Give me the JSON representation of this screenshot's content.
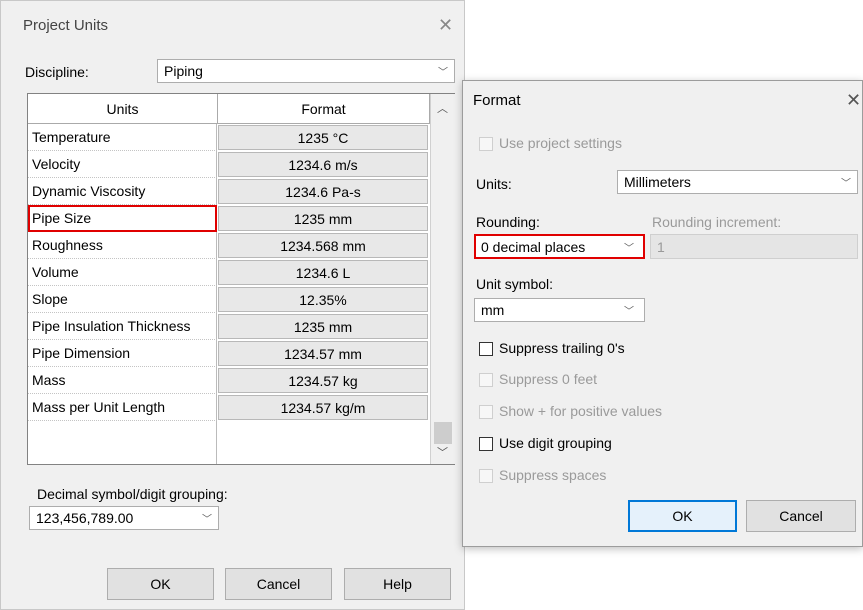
{
  "project_units": {
    "title": "Project Units",
    "discipline_label": "Discipline:",
    "discipline_value": "Piping",
    "table": {
      "headers": [
        "Units",
        "Format"
      ],
      "rows": [
        {
          "unit": "Temperature",
          "format": "1235 °C"
        },
        {
          "unit": "Velocity",
          "format": "1234.6 m/s"
        },
        {
          "unit": "Dynamic Viscosity",
          "format": "1234.6 Pa-s"
        },
        {
          "unit": "Pipe Size",
          "format": "1235 mm"
        },
        {
          "unit": "Roughness",
          "format": "1234.568 mm"
        },
        {
          "unit": "Volume",
          "format": "1234.6 L"
        },
        {
          "unit": "Slope",
          "format": "12.35%"
        },
        {
          "unit": "Pipe Insulation Thickness",
          "format": "1235 mm"
        },
        {
          "unit": "Pipe Dimension",
          "format": "1234.57 mm"
        },
        {
          "unit": "Mass",
          "format": "1234.57 kg"
        },
        {
          "unit": "Mass per Unit Length",
          "format": "1234.57 kg/m"
        }
      ]
    },
    "decimal_label": "Decimal symbol/digit grouping:",
    "decimal_value": "123,456,789.00",
    "ok_label": "OK",
    "cancel_label": "Cancel",
    "help_label": "Help"
  },
  "format": {
    "title": "Format",
    "use_project_settings": "Use project settings",
    "units_label": "Units:",
    "units_value": "Millimeters",
    "rounding_label": "Rounding:",
    "rounding_value": "0 decimal places",
    "rounding_increment_label": "Rounding increment:",
    "rounding_increment_value": "1",
    "unit_symbol_label": "Unit symbol:",
    "unit_symbol_value": "mm",
    "suppress_trailing": "Suppress trailing 0's",
    "suppress_feet": "Suppress 0 feet",
    "show_plus": "Show + for positive values",
    "digit_grouping": "Use digit grouping",
    "suppress_spaces": "Suppress spaces",
    "ok_label": "OK",
    "cancel_label": "Cancel"
  },
  "colors": {
    "highlight": "#e00000",
    "accent": "#0078d7"
  },
  "icons": {
    "close": "close-icon",
    "dropdown": "chevron-down-icon",
    "scroll_up": "chevron-up-icon",
    "scroll_down": "chevron-down-icon"
  }
}
